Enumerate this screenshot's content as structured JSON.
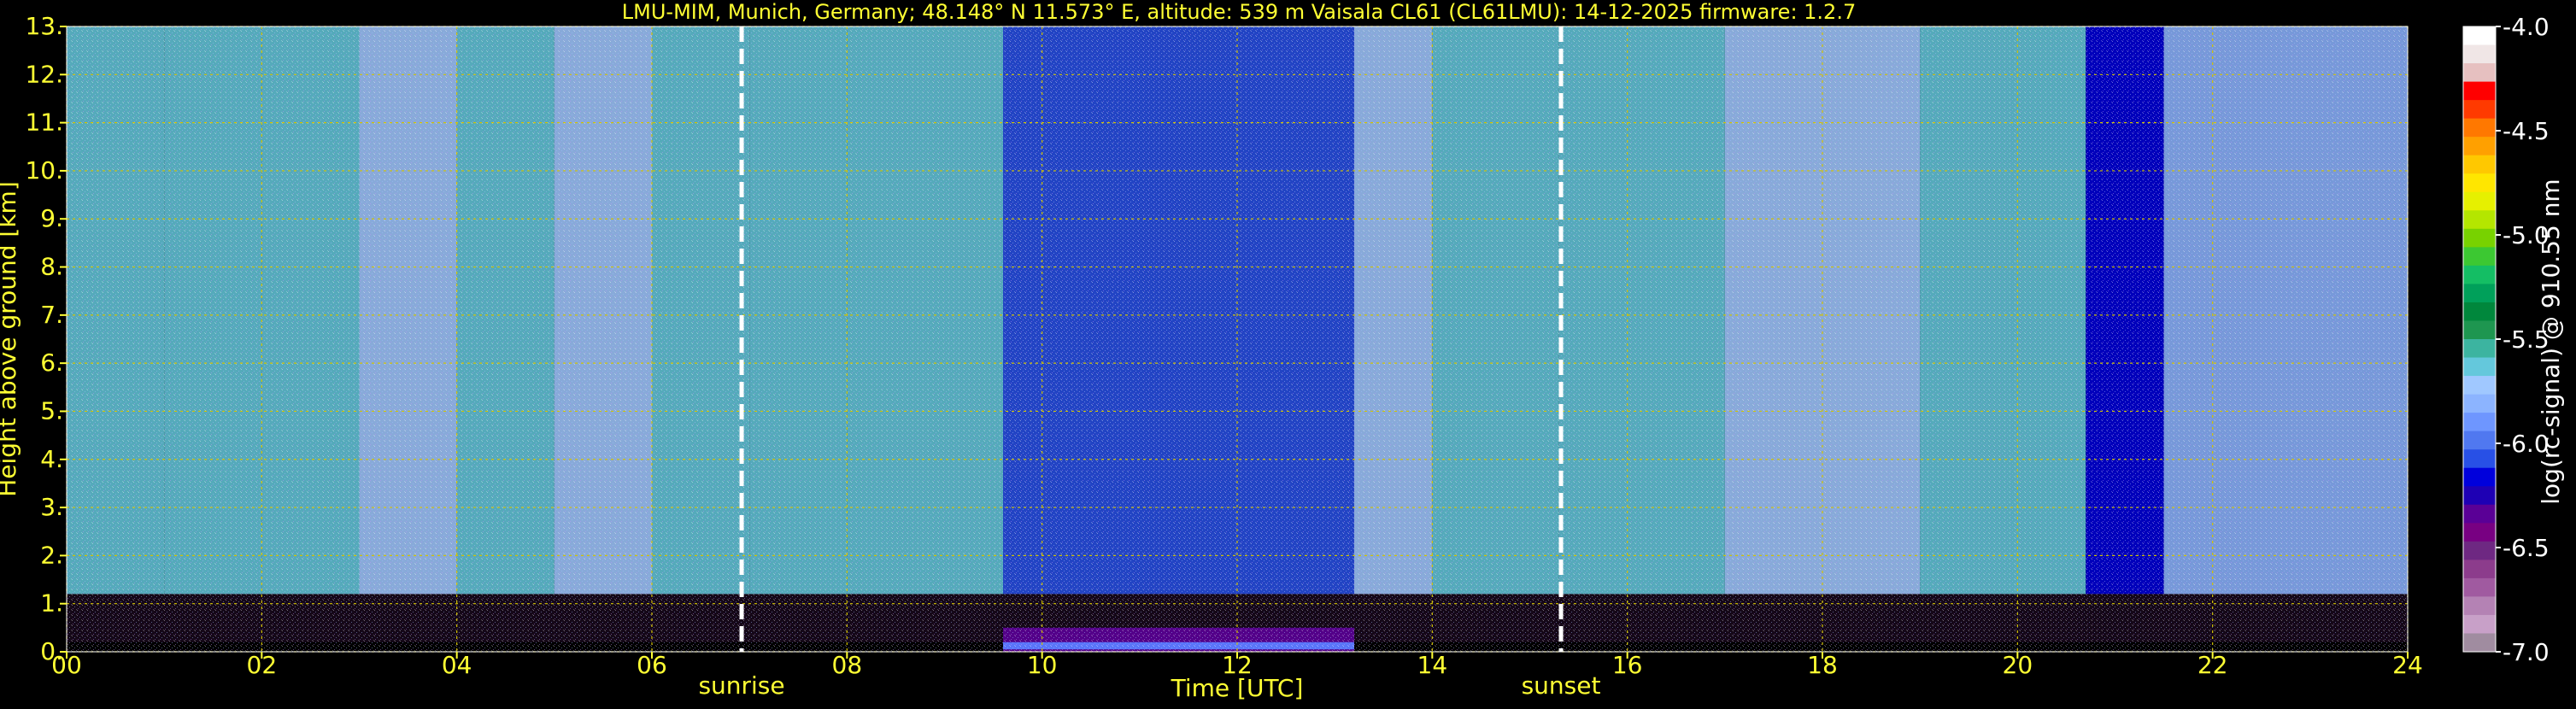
{
  "chart_data": {
    "type": "heatmap",
    "title": "LMU-MIM, Munich, Germany; 48.148° N 11.573° E, altitude: 539 m    Vaisala CL61 (CL61LMU): 14-12-2025    firmware: 1.2.7",
    "xlabel": "Time [UTC]",
    "ylabel": "Height above ground [km]",
    "xlim": [
      0,
      24
    ],
    "ylim": [
      0,
      13
    ],
    "x_ticks": [
      "00",
      "02",
      "04",
      "06",
      "08",
      "10",
      "12",
      "14",
      "16",
      "18",
      "20",
      "22",
      "24"
    ],
    "y_ticks": [
      "0.",
      "1.",
      "2.",
      "3.",
      "4.",
      "5.",
      "6.",
      "7.",
      "8.",
      "9.",
      "10.",
      "11.",
      "12.",
      "13."
    ],
    "grid": true,
    "grid_color": "#d4c400",
    "annotations": [
      {
        "label": "sunrise",
        "time": 6.92
      },
      {
        "label": "sunset",
        "time": 15.32
      }
    ],
    "colorbar": {
      "label": "log(rc-signal) @ 910.55 nm",
      "range": [
        -7.0,
        -4.0
      ],
      "ticks": [
        "-4.0",
        "-4.5",
        "-5.0",
        "-5.5",
        "-6.0",
        "-6.5",
        "-7.0"
      ],
      "colors": [
        "#ffffff",
        "#f0e6e6",
        "#e6c0c0",
        "#ff0000",
        "#ff3a00",
        "#ff7800",
        "#ffa000",
        "#ffc800",
        "#ffe600",
        "#e6f000",
        "#b4e600",
        "#78d200",
        "#3cc832",
        "#14be64",
        "#00a05a",
        "#00873c",
        "#1e9650",
        "#3cb4a0",
        "#64c8dc",
        "#a0c8ff",
        "#8cb4ff",
        "#6e96ff",
        "#5078f0",
        "#2850e6",
        "#0000dc",
        "#1e00b4",
        "#5a0096",
        "#780082",
        "#6e2882",
        "#8c3c8c",
        "#a05aa0",
        "#b482b4",
        "#c8a0c8",
        "#a08ca0"
      ]
    },
    "series": [
      {
        "start": 0.0,
        "end": 1.0,
        "level": -5.6
      },
      {
        "start": 1.0,
        "end": 2.0,
        "level": -5.65
      },
      {
        "start": 2.0,
        "end": 3.0,
        "level": -5.6
      },
      {
        "start": 3.0,
        "end": 4.0,
        "level": -5.7
      },
      {
        "start": 4.0,
        "end": 5.0,
        "level": -5.6
      },
      {
        "start": 5.0,
        "end": 6.0,
        "level": -5.7
      },
      {
        "start": 6.0,
        "end": 7.0,
        "level": -5.65
      },
      {
        "start": 7.0,
        "end": 8.0,
        "level": -5.6
      },
      {
        "start": 8.0,
        "end": 9.6,
        "level": -5.65
      },
      {
        "start": 9.6,
        "end": 13.2,
        "level": -6.1
      },
      {
        "start": 13.2,
        "end": 14.0,
        "level": -5.7
      },
      {
        "start": 14.0,
        "end": 15.3,
        "level": -5.65
      },
      {
        "start": 15.3,
        "end": 17.0,
        "level": -5.6
      },
      {
        "start": 17.0,
        "end": 19.0,
        "level": -5.75
      },
      {
        "start": 19.0,
        "end": 20.7,
        "level": -5.6
      },
      {
        "start": 20.7,
        "end": 21.5,
        "level": -6.2
      },
      {
        "start": 21.5,
        "end": 24.0,
        "level": -5.8
      }
    ],
    "aerosol_layer": {
      "start": 9.6,
      "end": 13.2,
      "top_km": 0.5,
      "level": -6.4
    }
  }
}
